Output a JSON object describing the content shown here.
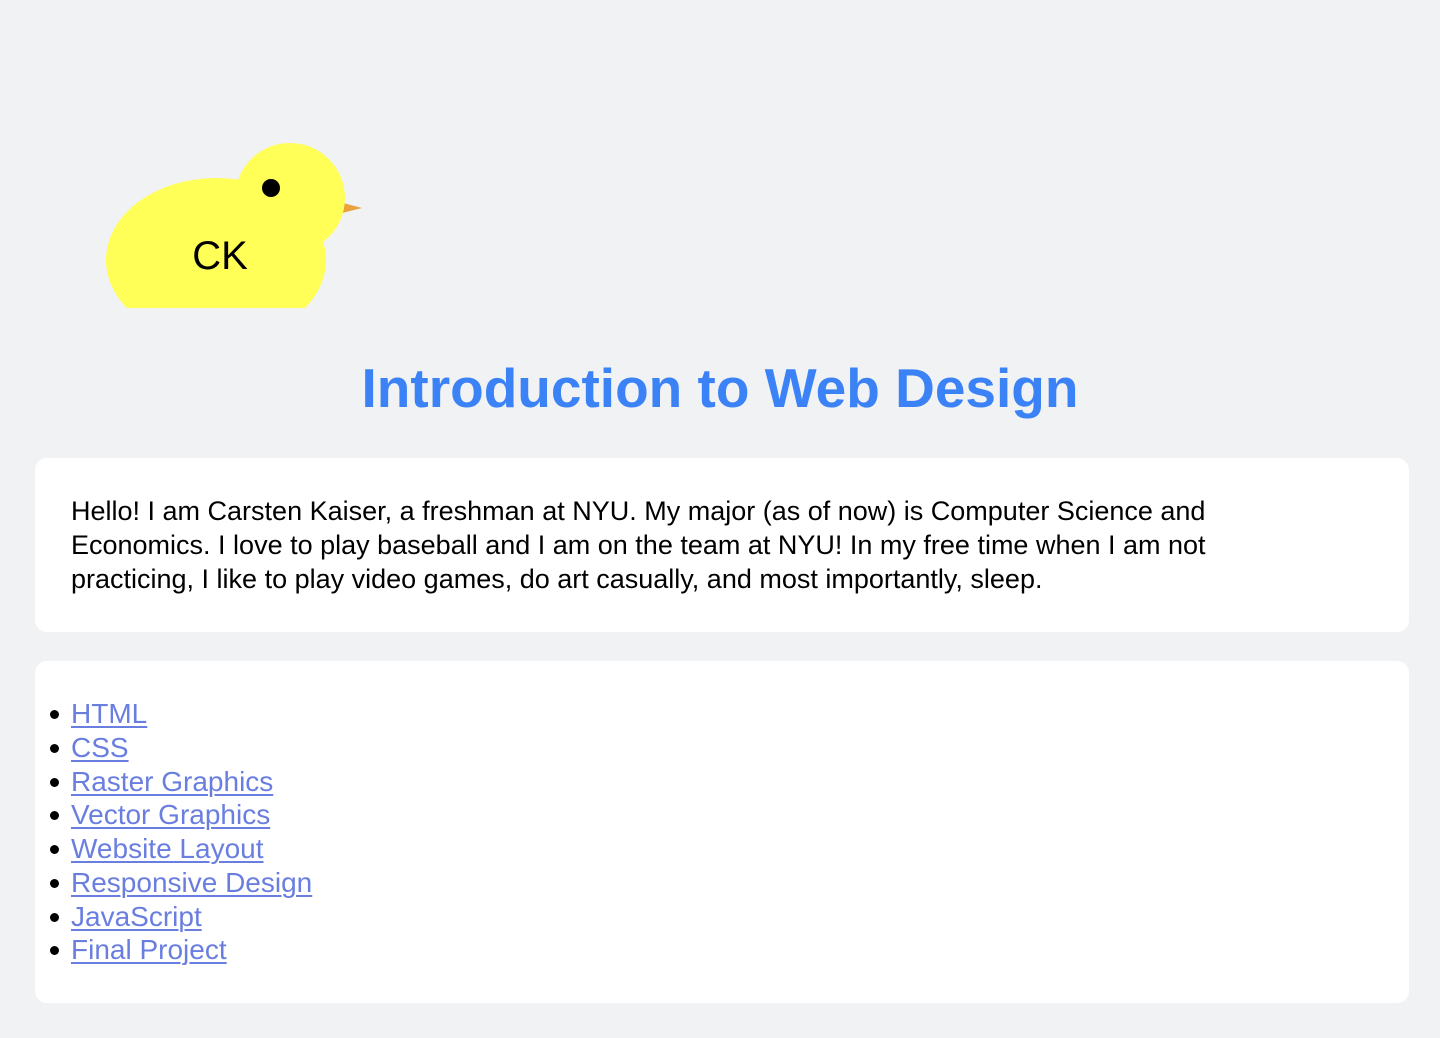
{
  "logo": {
    "initials": "CK",
    "body_color": "#ffff57",
    "beak_color": "#e8a33a",
    "eye_color": "#000000"
  },
  "header": {
    "title": "Introduction to Web Design",
    "title_color": "#3b82f6"
  },
  "about": {
    "text": "Hello! I am Carsten Kaiser, a freshman at NYU. My major (as of now) is Computer Science and Economics. I love to play baseball and I am on the team at NYU! In my free time when I am not practicing, I like to play video games, do art casually, and most importantly, sleep."
  },
  "topics": {
    "link_color": "#6a7ee0",
    "items": [
      {
        "label": "HTML"
      },
      {
        "label": "CSS"
      },
      {
        "label": "Raster Graphics"
      },
      {
        "label": "Vector Graphics"
      },
      {
        "label": "Website Layout"
      },
      {
        "label": "Responsive Design"
      },
      {
        "label": "JavaScript"
      },
      {
        "label": "Final Project"
      }
    ]
  }
}
